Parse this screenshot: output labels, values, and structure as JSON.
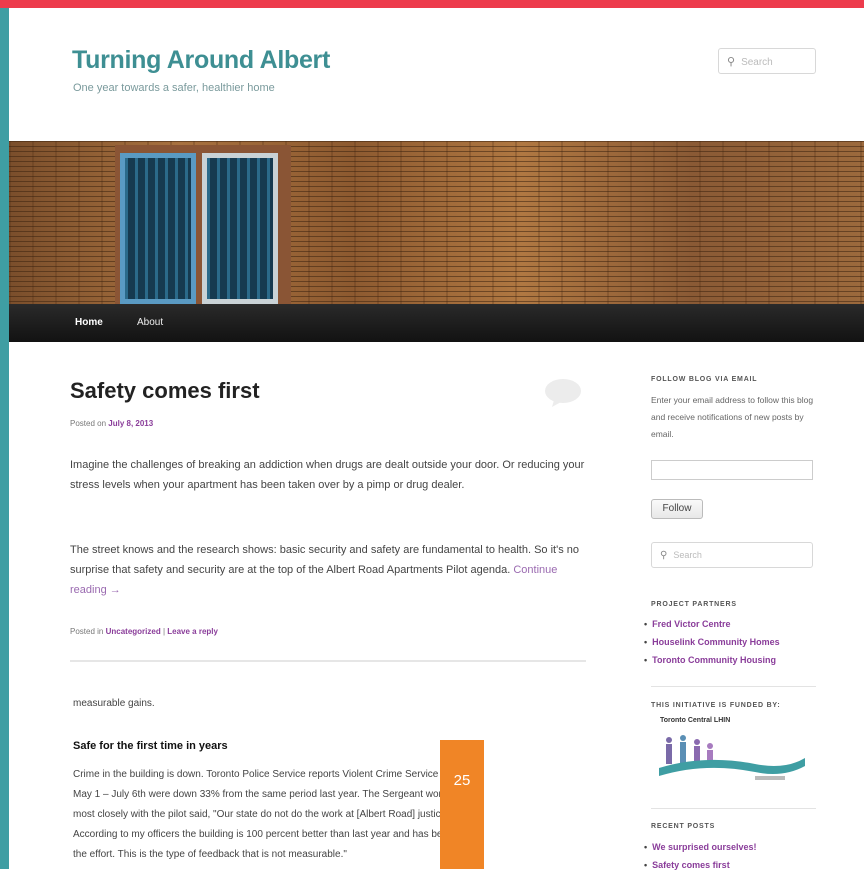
{
  "site": {
    "title": "Turning Around Albert",
    "description": "One year towards a safer, healthier home",
    "search_placeholder": "Search"
  },
  "colors": {
    "top_bar": "#ed3b4c",
    "left_bar": "#3f9ea3",
    "title": "#3e8f93",
    "link": "#8a3d9a",
    "page_badge": "#f08526"
  },
  "nav": {
    "items": [
      {
        "label": "Home"
      },
      {
        "label": "About"
      }
    ]
  },
  "post": {
    "title": "Safety comes first",
    "posted_on_prefix": "Posted on",
    "date": "July 8, 2013",
    "paragraph1": "Imagine the challenges of breaking an addiction when drugs are dealt outside your door. Or reducing your stress levels when your apartment has been taken over by a pimp or drug dealer.",
    "paragraph2": "The street knows and the research shows: basic security and safety are fundamental to health. So it's no surprise that safety and security are at the top of the Albert Road Apartments Pilot agenda.",
    "continue_reading": "Continue reading →",
    "posted_in_prefix": "Posted in",
    "category": "Uncategorized",
    "separator": "|",
    "leave_reply": "Leave a reply"
  },
  "lower": {
    "snippet": "measurable gains.",
    "heading": "Safe for the first time in years",
    "body_line1": "Crime in the building is down. Toronto Police Service reports Violent Crime Service between",
    "body_line2": "May 1 – July 6th were down 33% from the same period last year. The Sergeant working",
    "body_line3": "most closely with the pilot said, \"Our state do not do the work at [Albert Road] justice . . .",
    "body_line4": "According to my officers the building is 100 percent better than last year and has been worth",
    "body_line5": "the effort. This is the type of feedback that is not measurable.\""
  },
  "page_number": "25",
  "sidebar": {
    "follow_title": "FOLLOW BLOG VIA EMAIL",
    "follow_text": "Enter your email address to follow this blog and receive notifications of new posts by email.",
    "follow_button": "Follow",
    "search_placeholder": "Search",
    "partners_title": "PROJECT PARTNERS",
    "partners": [
      "Fred Victor Centre",
      "Houselink Community Homes",
      "Toronto Community Housing"
    ],
    "funded_title": "THIS INITIATIVE IS FUNDED BY:",
    "funder_name": "Toronto Central LHIN",
    "recent_title": "RECENT POSTS",
    "recent": [
      "We surprised ourselves!",
      "Safety comes first"
    ]
  }
}
